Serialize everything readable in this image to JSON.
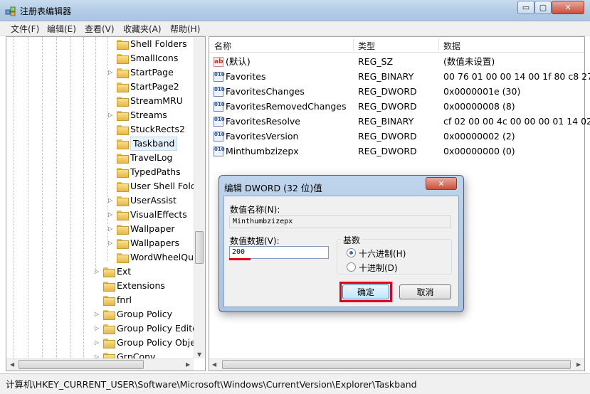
{
  "window": {
    "title": "注册表编辑器",
    "min_glyph": "▭",
    "max_glyph": "▢",
    "close_glyph": "✕"
  },
  "menu": [
    "文件(F)",
    "编辑(E)",
    "查看(V)",
    "收藏夹(A)",
    "帮助(H)"
  ],
  "tree": {
    "items": [
      {
        "label": "Shell Folders",
        "expander": ""
      },
      {
        "label": "SmallIcons",
        "expander": ""
      },
      {
        "label": "StartPage",
        "expander": "▷"
      },
      {
        "label": "StartPage2",
        "expander": ""
      },
      {
        "label": "StreamMRU",
        "expander": ""
      },
      {
        "label": "Streams",
        "expander": "▷"
      },
      {
        "label": "StuckRects2",
        "expander": ""
      },
      {
        "label": "Taskband",
        "expander": "",
        "selected": true
      },
      {
        "label": "TravelLog",
        "expander": ""
      },
      {
        "label": "TypedPaths",
        "expander": ""
      },
      {
        "label": "User Shell Folc",
        "expander": ""
      },
      {
        "label": "UserAssist",
        "expander": "▷"
      },
      {
        "label": "VisualEffects",
        "expander": "▷"
      },
      {
        "label": "Wallpaper",
        "expander": "▷"
      },
      {
        "label": "Wallpapers",
        "expander": "▷"
      },
      {
        "label": "WordWheelQu",
        "expander": ""
      },
      {
        "label": "Ext",
        "expander": "▷"
      },
      {
        "label": "Extensions",
        "expander": ""
      },
      {
        "label": "fnrl",
        "expander": ""
      },
      {
        "label": "Group Policy",
        "expander": "▷"
      },
      {
        "label": "Group Policy Edito",
        "expander": "▷"
      },
      {
        "label": "Group Policy Obje",
        "expander": "▷"
      },
      {
        "label": "GrpConv",
        "expander": "▷"
      }
    ]
  },
  "list": {
    "columns": [
      "名称",
      "类型",
      "数据"
    ],
    "rows": [
      {
        "icon": "string-value-icon",
        "icon_text": "ab",
        "name": "(默认)",
        "type": "REG_SZ",
        "data": "(数值未设置)"
      },
      {
        "icon": "binary-value-icon",
        "icon_text": "010",
        "name": "Favorites",
        "type": "REG_BINARY",
        "data": "00 76 01 00 00 14 00 1f 80 c8 27 3"
      },
      {
        "icon": "binary-value-icon",
        "icon_text": "010",
        "name": "FavoritesChanges",
        "type": "REG_DWORD",
        "data": "0x0000001e (30)"
      },
      {
        "icon": "binary-value-icon",
        "icon_text": "010",
        "name": "FavoritesRemovedChanges",
        "type": "REG_DWORD",
        "data": "0x00000008 (8)"
      },
      {
        "icon": "binary-value-icon",
        "icon_text": "010",
        "name": "FavoritesResolve",
        "type": "REG_BINARY",
        "data": "cf 02 00 00 4c 00 00 00 01 14 02 0"
      },
      {
        "icon": "binary-value-icon",
        "icon_text": "010",
        "name": "FavoritesVersion",
        "type": "REG_DWORD",
        "data": "0x00000002 (2)"
      },
      {
        "icon": "binary-value-icon",
        "icon_text": "010",
        "name": "Minthumbzizepx",
        "type": "REG_DWORD",
        "data": "0x00000000 (0)"
      }
    ]
  },
  "status": {
    "path": "计算机\\HKEY_CURRENT_USER\\Software\\Microsoft\\Windows\\CurrentVersion\\Explorer\\Taskband"
  },
  "dialog": {
    "title": "编辑 DWORD (32 位)值",
    "name_label": "数值名称(N):",
    "name_value": "Minthumbzizepx",
    "data_label": "数值数据(V):",
    "data_value": "200",
    "base_label": "基数",
    "radio_hex": "十六进制(H)",
    "radio_dec": "十进制(D)",
    "selected_base": "hex",
    "ok_label": "确定",
    "cancel_label": "取消",
    "close_glyph": "✕",
    "highlight_color": "#e0001a"
  }
}
